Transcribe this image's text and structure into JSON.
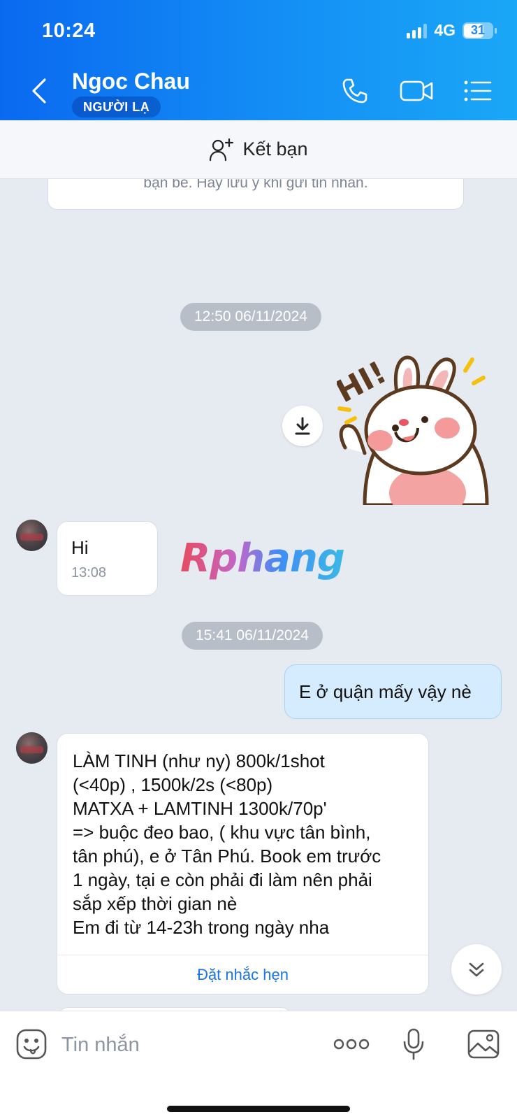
{
  "status_bar": {
    "time": "10:24",
    "network": "4G",
    "battery": "31"
  },
  "header": {
    "name": "Ngoc Chau",
    "badge": "NGƯỜI LẠ"
  },
  "add_friend": {
    "label": "Kết bạn"
  },
  "notice": {
    "text": "bạn bè. Hãy lưu ý khi gửi tin nhắn."
  },
  "timestamps": [
    "12:50 06/11/2024",
    "15:41 06/11/2024"
  ],
  "watermark": "Rphang",
  "messages": {
    "hi": {
      "text": "Hi",
      "time": "13:08"
    },
    "outgoing": {
      "text": "E ở quận mấy vậy nè"
    },
    "long": {
      "lines": [
        "LÀM TINH (như ny) 800k/1shot",
        "(<40p) , 1500k/2s (<80p)",
        "MATXA + LAMTINH 1300k/70p'",
        "=> buộc đeo bao, ( khu vực tân bình,",
        "tân phú), e ở Tân Phú. Book em trước",
        "1 ngày, tại e còn phải đi làm nên phải",
        "sắp xếp thời gian nè",
        "Em đi từ 14-23h trong ngày nha"
      ],
      "action": "Đặt nhắc hẹn"
    }
  },
  "input": {
    "placeholder": "Tin nhắn"
  },
  "sticker": {
    "text": "HI!"
  },
  "icons": [
    "back-icon",
    "phone-icon",
    "video-icon",
    "menu-icon",
    "add-user-icon",
    "download-icon",
    "chevron-double-down-icon",
    "emoji-icon",
    "more-icon",
    "microphone-icon",
    "image-icon"
  ],
  "colors": {
    "header_start": "#0a69f0",
    "header_end": "#1aa7f7",
    "outgoing_bubble": "#d4ecfd",
    "link": "#1a73e8",
    "chat_bg": "#e6eaf1"
  }
}
